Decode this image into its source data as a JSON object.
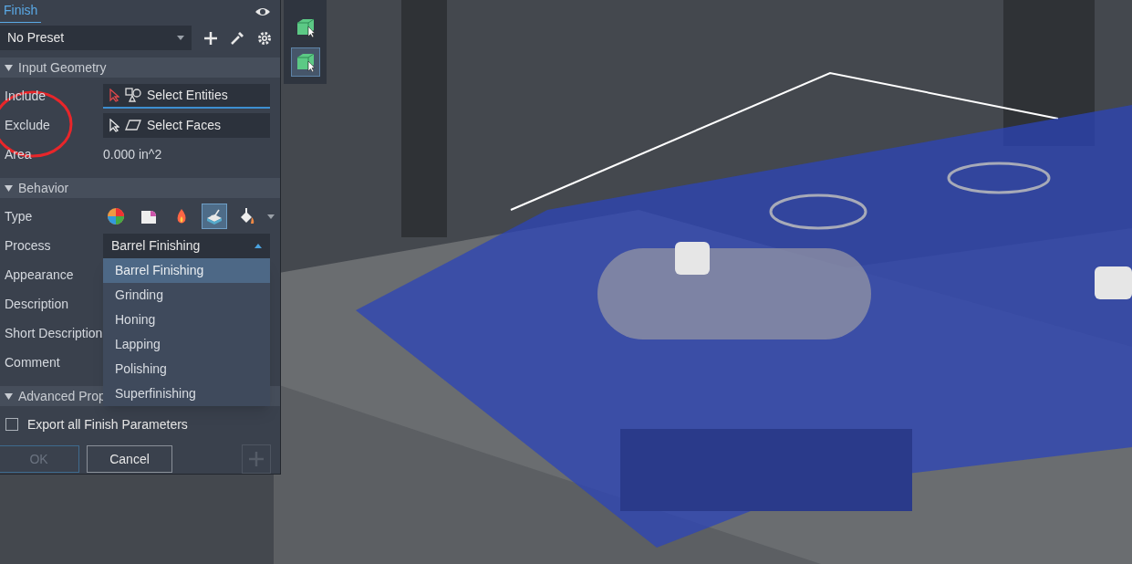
{
  "panel": {
    "title": "Finish",
    "preset": "No Preset",
    "sections": [
      {
        "title": "Input Geometry",
        "expanded": true,
        "rows": [
          {
            "kind": "picker",
            "label": "Include",
            "value": "Select Entities",
            "selected": true
          },
          {
            "kind": "picker",
            "label": "Exclude",
            "value": "Select Faces",
            "selected": false
          },
          {
            "kind": "text",
            "label": "Area",
            "value": "0.000 in^2"
          }
        ]
      },
      {
        "title": "Behavior",
        "expanded": true,
        "rows": [
          {
            "kind": "types",
            "label": "Type",
            "types": [
              {
                "selected": false
              },
              {
                "selected": false
              },
              {
                "selected": false
              },
              {
                "selected": true
              },
              {
                "selected": false
              }
            ]
          },
          {
            "kind": "dropdown",
            "label": "Process",
            "value": "Barrel Finishing",
            "expanded": true,
            "options": [
              {
                "label": "Barrel Finishing",
                "selected": true
              },
              {
                "label": "Grinding",
                "selected": false
              },
              {
                "label": "Honing",
                "selected": false
              },
              {
                "label": "Lapping",
                "selected": false
              },
              {
                "label": "Polishing",
                "selected": false
              },
              {
                "label": "Superfinishing",
                "selected": false
              }
            ]
          },
          {
            "kind": "label",
            "label": "Appearance"
          },
          {
            "kind": "label",
            "label": "Description"
          },
          {
            "kind": "label",
            "label": "Short Description"
          },
          {
            "kind": "label",
            "label": "Comment"
          }
        ]
      },
      {
        "title": "Advanced Prop",
        "expanded": true,
        "rows": [
          {
            "kind": "checkbox",
            "label": "Export all Finish Parameters",
            "checked": false
          }
        ]
      }
    ],
    "buttons": [
      {
        "label": "OK",
        "disabled": true
      },
      {
        "label": "Cancel",
        "disabled": false
      }
    ]
  },
  "toolbar": [
    {
      "selected": false
    },
    {
      "selected": true
    }
  ]
}
